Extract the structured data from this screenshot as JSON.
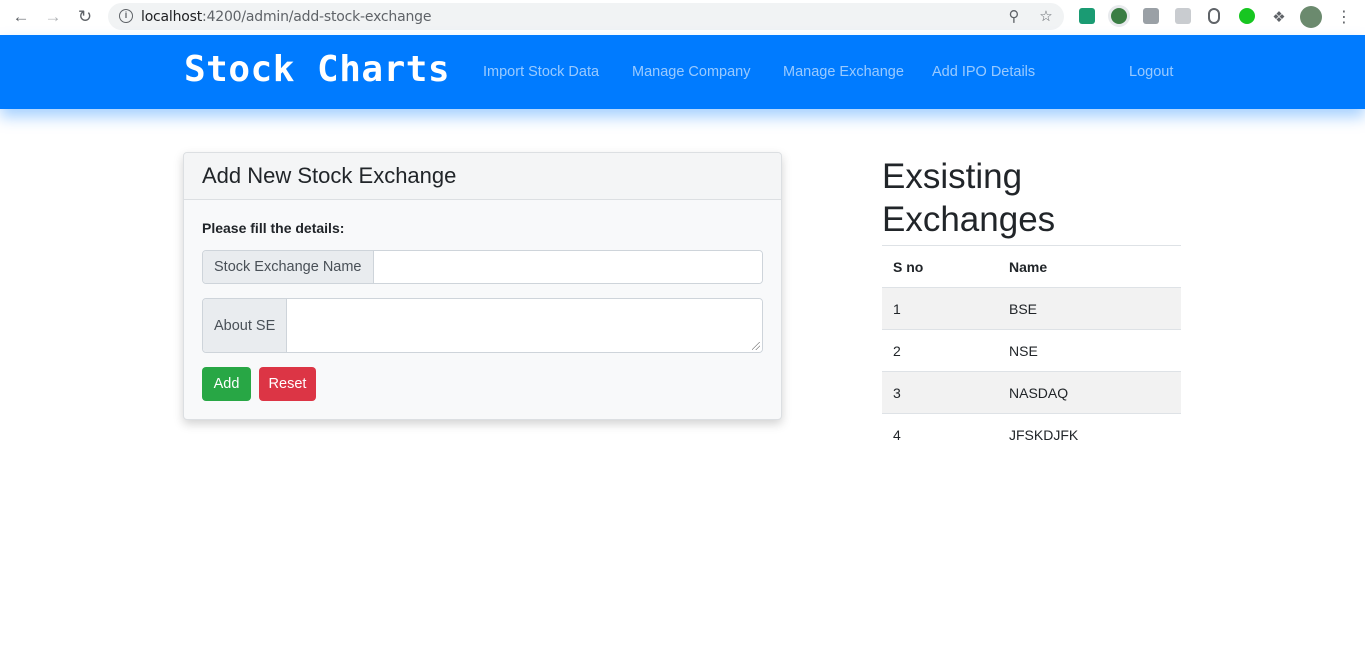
{
  "browser": {
    "url_host": "localhost",
    "url_rest": ":4200/admin/add-stock-exchange"
  },
  "navbar": {
    "brand": "Stock Charts",
    "links": [
      "Import Stock Data",
      "Manage Company",
      "Manage Exchange",
      "Add IPO Details"
    ],
    "logout": "Logout"
  },
  "form": {
    "title": "Add New Stock Exchange",
    "subtitle": "Please fill the details:",
    "name_label": "Stock Exchange Name",
    "name_value": "",
    "about_label": "About SE",
    "about_value": "",
    "add_label": "Add",
    "reset_label": "Reset"
  },
  "exchanges": {
    "title_line1": "Exsisting",
    "title_line2": "Exchanges",
    "headers": [
      "S no",
      "Name"
    ],
    "rows": [
      [
        "1",
        "BSE"
      ],
      [
        "2",
        "NSE"
      ],
      [
        "3",
        "NASDAQ"
      ],
      [
        "4",
        "JFSKDJFK"
      ]
    ]
  },
  "colors": {
    "navbar": "#007bff",
    "add_button": "#28a745",
    "reset_button": "#dc3545"
  }
}
